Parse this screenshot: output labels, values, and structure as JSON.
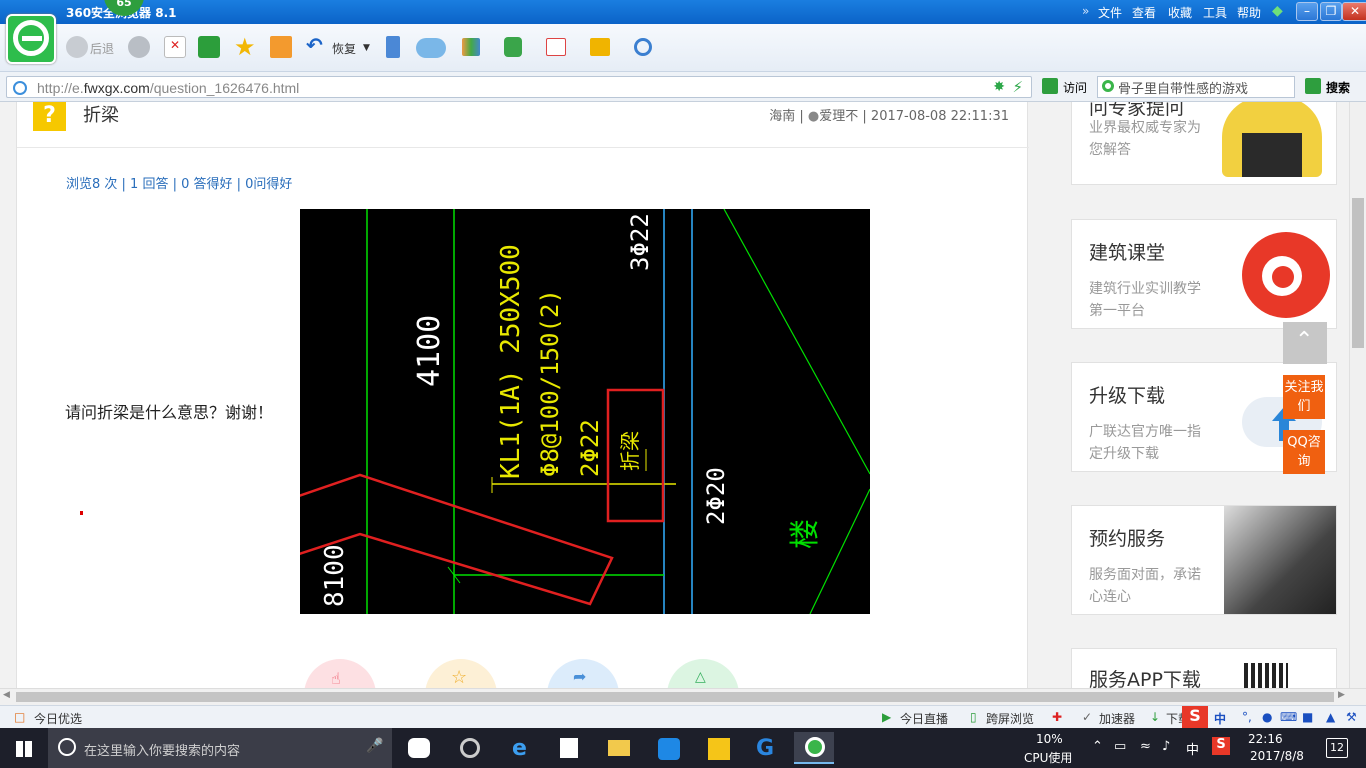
{
  "browser": {
    "title": "360安全浏览器 8.1",
    "menu": [
      "文件",
      "查看",
      "收藏",
      "工具",
      "帮助"
    ],
    "badge": "65",
    "back_label": "后退",
    "restore_label": "恢复",
    "url_prefix": "http://e.",
    "url_host": "fwxgx.com",
    "url_path": "/question_1626476.html",
    "visit_label": "访问",
    "search_placeholder": "骨子里自带性感的游戏",
    "search_label": "搜索"
  },
  "question": {
    "title": "折梁",
    "location": "海南",
    "user": "爱理不",
    "datetime": "2017-08-08 22:11:31",
    "stats": "浏览8 次 | 1 回答 | 0 答得好 | 0问得好",
    "text": "请问折梁是什么意思？谢谢！"
  },
  "cad": {
    "dim_4100": "4100",
    "beam_label": "KL1(1A) 250X500",
    "stirrup": "Φ8@100/150(2)",
    "bar_top": "2Φ22",
    "fold_label": "折梁",
    "bar_3": "3Φ22",
    "bar_2": "2Φ20",
    "stair": "楼",
    "dim_8100": "8100"
  },
  "sidebar": [
    {
      "title": "问专家提问",
      "desc": "业界最权威专家为您解答"
    },
    {
      "title": "建筑课堂",
      "desc": "建筑行业实训教学第一平台"
    },
    {
      "title": "升级下载",
      "desc": "广联达官方唯一指定升级下载"
    },
    {
      "title": "预约服务",
      "desc": "服务面对面，承诺心连心"
    },
    {
      "title": "服务APP下载",
      "desc": ""
    }
  ],
  "float": {
    "follow": "关注我们",
    "qq": "QQ咨询"
  },
  "statusbar": {
    "left": "今日优选",
    "live": "今日直播",
    "cross": "跨屏浏览",
    "accel": "加速器",
    "download": "下载",
    "ime": "中"
  },
  "taskbar": {
    "search_placeholder": "在这里输入你要搜索的内容",
    "cpu_percent": "10%",
    "cpu_label": "CPU使用",
    "ime": "中",
    "time": "22:16",
    "date": "2017/8/8",
    "notifications": "12"
  }
}
